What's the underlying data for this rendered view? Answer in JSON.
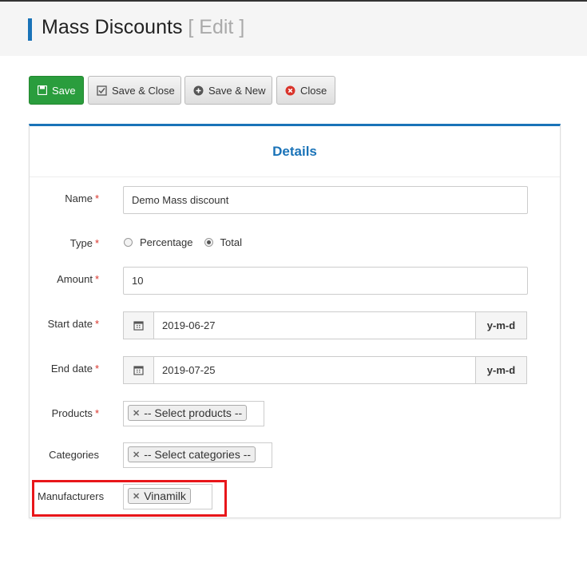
{
  "page": {
    "title": "Mass Discounts",
    "subtitle": "[ Edit ]"
  },
  "toolbar": {
    "save_label": "Save",
    "save_close_label": "Save & Close",
    "save_new_label": "Save & New",
    "close_label": "Close"
  },
  "form": {
    "section_title": "Details",
    "name": {
      "label": "Name",
      "value": "Demo Mass discount"
    },
    "type": {
      "label": "Type",
      "options": [
        "Percentage",
        "Total"
      ],
      "selected": "Total"
    },
    "amount": {
      "label": "Amount",
      "value": "10"
    },
    "start_date": {
      "label": "Start date",
      "value": "2019-06-27",
      "format": "y-m-d"
    },
    "end_date": {
      "label": "End date",
      "value": "2019-07-25",
      "format": "y-m-d"
    },
    "products": {
      "label": "Products",
      "tag": "-- Select products --"
    },
    "categories": {
      "label": "Categories",
      "tag": "-- Select categories --"
    },
    "manufacturers": {
      "label": "Manufacturers",
      "tag": "Vinamilk"
    },
    "required_marker": "*"
  },
  "colors": {
    "accent": "#1a73b8",
    "save_button": "#2a9d3d",
    "required": "#d9342b",
    "highlight_box": "#e8161a"
  }
}
